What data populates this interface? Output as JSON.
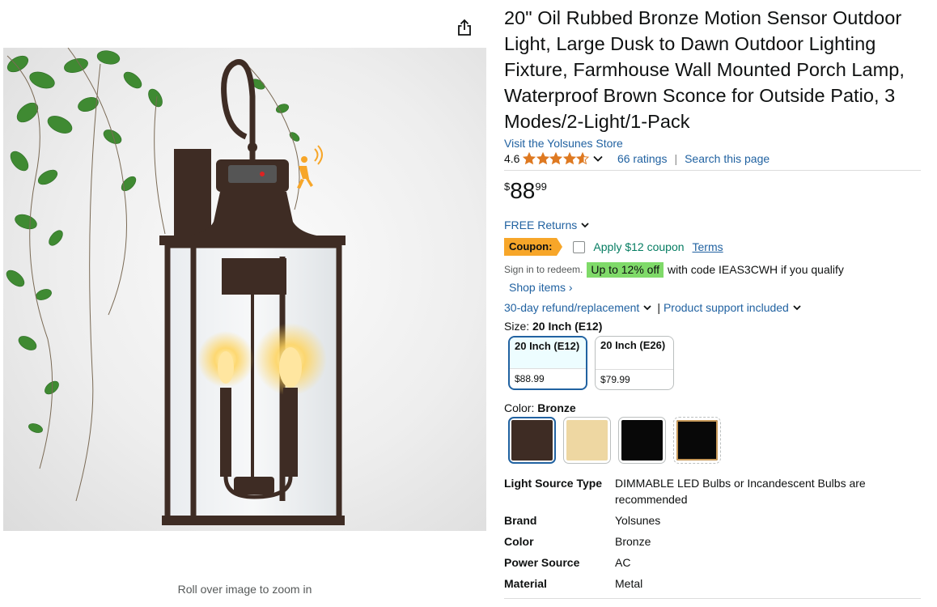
{
  "product": {
    "title": "20\" Oil Rubbed Bronze Motion Sensor Outdoor Light, Large Dusk to Dawn Outdoor Lighting Fixture, Farmhouse Wall Mounted Porch Lamp, Waterproof Brown Sconce for Outside Patio, 3 Modes/2-Light/1-Pack",
    "store_link": "Visit the Yolsunes Store"
  },
  "rating": {
    "value": "4.6",
    "stars": 4.6,
    "ratings_link": "66 ratings",
    "separator": "|",
    "search_link": "Search this page"
  },
  "price": {
    "symbol": "$",
    "whole": "88",
    "fraction": "99"
  },
  "returns": {
    "label": "FREE Returns"
  },
  "coupon": {
    "badge": "Coupon:",
    "text": "Apply $12 coupon",
    "terms": "Terms"
  },
  "promo": {
    "sign_in": "Sign in to redeem.",
    "badge": "Up to 12% off",
    "text": "with code IEAS3CWH if you qualify",
    "shop_items": "Shop items ›"
  },
  "support": {
    "refund": "30-day refund/replacement",
    "bar": "|",
    "product_support": "Product support included"
  },
  "size": {
    "label": "Size:",
    "selected": "20 Inch (E12)",
    "options": [
      {
        "name": "20 Inch (E12)",
        "price": "$88.99"
      },
      {
        "name": "20 Inch (E26)",
        "price": "$79.99"
      }
    ]
  },
  "color": {
    "label": "Color:",
    "selected": "Bronze",
    "swatches": [
      "#3e2c24",
      "#eed7a2",
      "#080808",
      "#080808"
    ]
  },
  "specs": [
    {
      "key": "Light Source Type",
      "value": "DIMMABLE LED Bulbs or Incandescent Bulbs are recommended"
    },
    {
      "key": "Brand",
      "value": "Yolsunes"
    },
    {
      "key": "Color",
      "value": "Bronze"
    },
    {
      "key": "Power Source",
      "value": "AC"
    },
    {
      "key": "Material",
      "value": "Metal"
    }
  ],
  "image": {
    "zoom_hint": "Roll over image to zoom in"
  },
  "colors": {
    "link": "#2162a1",
    "coupon": "#f7a629",
    "deal": "#7fda69",
    "star": "#de7921",
    "bronze": "#3e2c24"
  }
}
